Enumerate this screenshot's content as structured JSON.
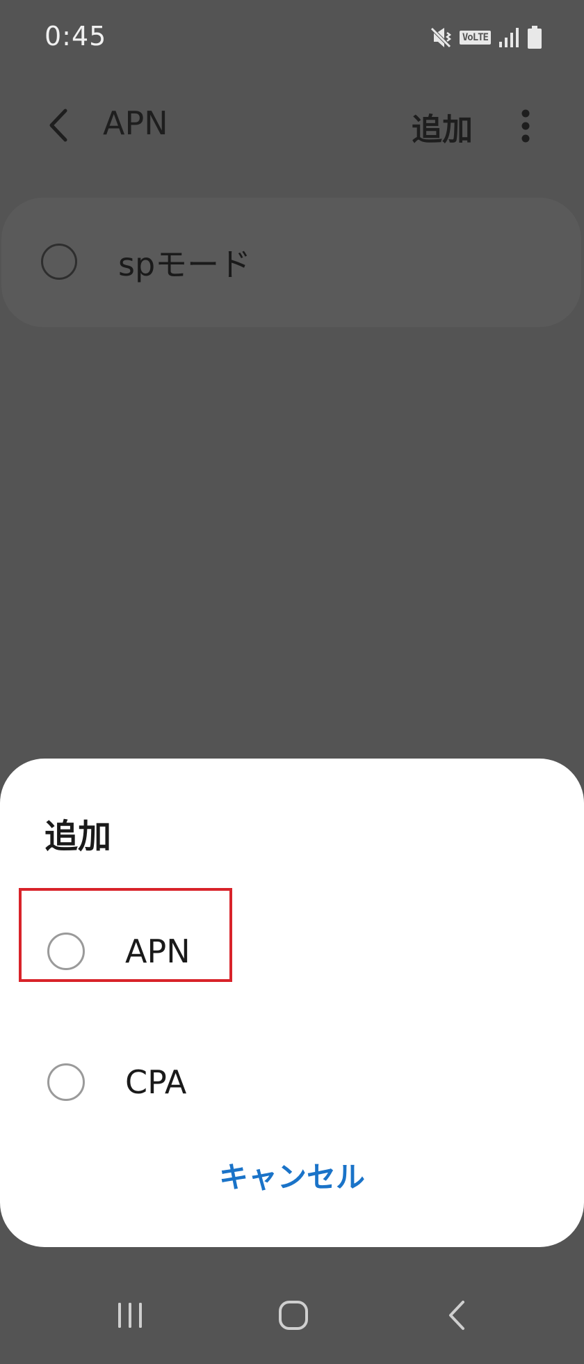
{
  "status_bar": {
    "time": "0:45",
    "icons": [
      "mute-vibrate-icon",
      "volte-icon",
      "signal-icon",
      "battery-icon"
    ],
    "volte_label": "VoLTE"
  },
  "app_bar": {
    "title": "APN",
    "add_label": "追加",
    "back_icon": "chevron-left-icon",
    "more_icon": "more-vertical-icon"
  },
  "apn_list": [
    {
      "name": "spモード",
      "selected": false
    }
  ],
  "dialog": {
    "title": "追加",
    "options": [
      {
        "label": "APN",
        "selected": false
      },
      {
        "label": "CPA",
        "selected": false
      }
    ],
    "cancel_label": "キャンセル"
  },
  "nav_bar": {
    "icons": [
      "recents-icon",
      "home-icon",
      "back-icon"
    ]
  },
  "colors": {
    "overlay_background": "#545454",
    "dialog_background": "#ffffff",
    "accent": "#1a73c8",
    "highlight": "#d8232a"
  }
}
